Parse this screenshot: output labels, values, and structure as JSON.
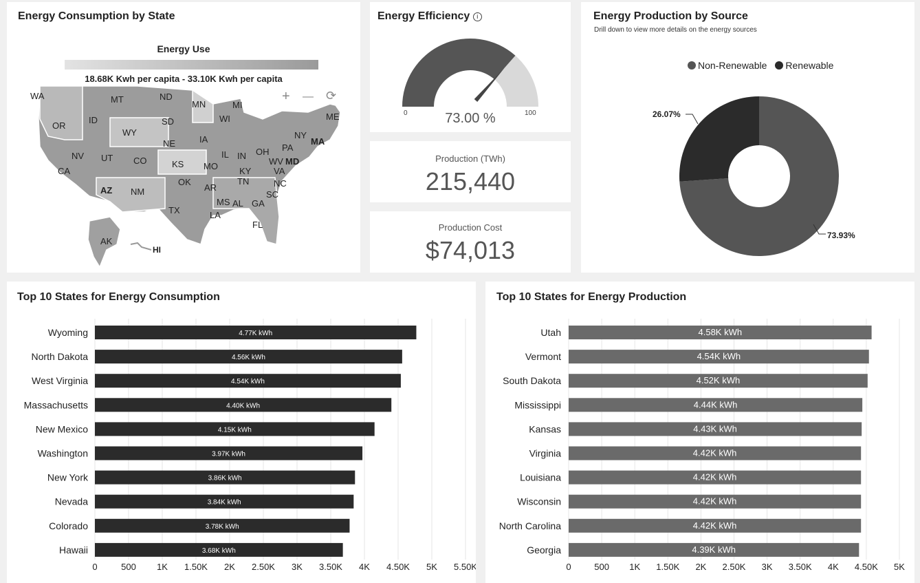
{
  "map_card": {
    "title": "Energy Consumption by State",
    "legend_title": "Energy Use",
    "legend_range": "18.68K Kwh per capita - 33.10K Kwh per capita",
    "controls": {
      "zoom_in": "+",
      "zoom_out": "—",
      "reset": "⟳"
    },
    "states": [
      "WA",
      "MT",
      "ND",
      "MN",
      "MI",
      "OR",
      "ID",
      "SD",
      "WI",
      "ME",
      "WY",
      "NY",
      "MA",
      "NE",
      "IA",
      "PA",
      "NV",
      "UT",
      "CO",
      "IL",
      "IN",
      "OH",
      "WV",
      "MD",
      "KS",
      "MO",
      "KY",
      "VA",
      "CA",
      "OK",
      "TN",
      "NC",
      "AZ",
      "NM",
      "AR",
      "SC",
      "MS",
      "AL",
      "GA",
      "TX",
      "LA",
      "FL",
      "AK",
      "HI"
    ]
  },
  "gauge_card": {
    "title": "Energy Efficiency",
    "info_icon": "info-icon",
    "value": 73,
    "value_text": "73.00 %",
    "min": "0",
    "max": "100"
  },
  "production_card": {
    "label": "Production (TWh)",
    "value": "215,440"
  },
  "cost_card": {
    "label": "Production Cost",
    "value": "$74,013"
  },
  "donut_card": {
    "title": "Energy Production by Source",
    "subtitle": "Drill down to view more details on the energy sources",
    "legend": [
      {
        "name": "Non-Renewable",
        "color": "#555555"
      },
      {
        "name": "Renewable",
        "color": "#2b2b2b"
      }
    ],
    "pct_small": "26.07%",
    "pct_large": "73.93%"
  },
  "consumption_card": {
    "title": "Top 10 States for Energy Consumption"
  },
  "production_states_card": {
    "title": "Top 10 States for Energy Production"
  },
  "chart_data": [
    {
      "type": "bar",
      "orientation": "horizontal",
      "title": "Top 10 States for Energy Consumption",
      "categories": [
        "Wyoming",
        "North Dakota",
        "West Virginia",
        "Massachusetts",
        "New Mexico",
        "Washington",
        "New York",
        "Nevada",
        "Colorado",
        "Hawaii"
      ],
      "values": [
        4770,
        4560,
        4540,
        4400,
        4150,
        3970,
        3860,
        3840,
        3780,
        3680
      ],
      "labels": [
        "4.77K kWh",
        "4.56K kWh",
        "4.54K kWh",
        "4.40K kWh",
        "4.15K kWh",
        "3.97K kWh",
        "3.86K kWh",
        "3.84K kWh",
        "3.78K kWh",
        "3.68K kWh"
      ],
      "xlim": [
        0,
        5500
      ],
      "ticks": [
        "0",
        "500",
        "1K",
        "1.50K",
        "2K",
        "2.50K",
        "3K",
        "3.50K",
        "4K",
        "4.50K",
        "5K",
        "5.50K"
      ],
      "color": "#2b2b2b",
      "grid": true
    },
    {
      "type": "bar",
      "orientation": "horizontal",
      "title": "Top 10 States for Energy Production",
      "categories": [
        "Utah",
        "Vermont",
        "South Dakota",
        "Mississippi",
        "Kansas",
        "Virginia",
        "Louisiana",
        "Wisconsin",
        "North Carolina",
        "Georgia"
      ],
      "values": [
        4580,
        4540,
        4520,
        4440,
        4430,
        4420,
        4420,
        4420,
        4420,
        4390
      ],
      "labels": [
        "4.58K kWh",
        "4.54K kWh",
        "4.52K kWh",
        "4.44K kWh",
        "4.43K kWh",
        "4.42K kWh",
        "4.42K kWh",
        "4.42K kWh",
        "4.42K kWh",
        "4.39K kWh"
      ],
      "xlim": [
        0,
        5000
      ],
      "ticks": [
        "0",
        "500",
        "1K",
        "1.50K",
        "2K",
        "2.50K",
        "3K",
        "3.50K",
        "4K",
        "4.50K",
        "5K"
      ],
      "color": "#6a6a6a",
      "grid": true
    }
  ]
}
